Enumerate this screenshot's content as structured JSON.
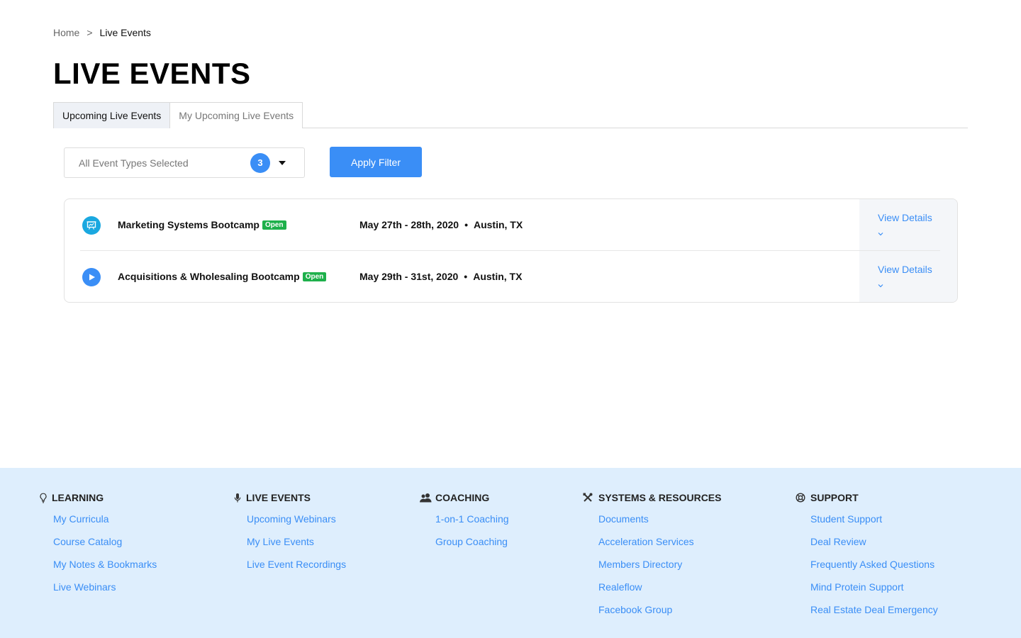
{
  "breadcrumb": {
    "home": "Home",
    "separator": ">",
    "current": "Live Events"
  },
  "page": {
    "title": "LIVE EVENTS"
  },
  "tabs": [
    {
      "label": "Upcoming Live Events",
      "active": true
    },
    {
      "label": "My Upcoming Live Events",
      "active": false
    }
  ],
  "filter": {
    "placeholder": "All Event Types Selected",
    "count": "3",
    "apply_label": "Apply Filter"
  },
  "events": [
    {
      "icon": "presentation-icon",
      "name": "Marketing Systems Bootcamp",
      "status": "Open",
      "dates": "May 27th - 28th, 2020",
      "separator": "•",
      "location": "Austin, TX",
      "details_label": "View Details"
    },
    {
      "icon": "play-icon",
      "name": "Acquisitions & Wholesaling Bootcamp",
      "status": "Open",
      "dates": "May 29th - 31st, 2020",
      "separator": "•",
      "location": "Austin, TX",
      "details_label": "View Details"
    }
  ],
  "footer": {
    "learning": {
      "icon": "lightbulb-icon",
      "heading": "LEARNING",
      "links": [
        "My Curricula",
        "Course Catalog",
        "My Notes & Bookmarks",
        "Live Webinars"
      ]
    },
    "live_events": {
      "icon": "microphone-icon",
      "heading": "LIVE EVENTS",
      "links": [
        "Upcoming Webinars",
        "My Live Events",
        "Live Event Recordings"
      ]
    },
    "coaching": {
      "icon": "users-icon",
      "heading": "COACHING",
      "links": [
        "1-on-1 Coaching",
        "Group Coaching"
      ]
    },
    "systems": {
      "icon": "tools-icon",
      "heading": "SYSTEMS & RESOURCES",
      "links": [
        "Documents",
        "Acceleration Services",
        "Members Directory",
        "Realeflow",
        "Facebook Group"
      ]
    },
    "support": {
      "icon": "lifebuoy-icon",
      "heading": "SUPPORT",
      "links": [
        "Student Support",
        "Deal Review",
        "Frequently Asked Questions",
        "Mind Protein Support",
        "Real Estate Deal Emergency"
      ]
    }
  },
  "colors": {
    "accent": "#3a8ef6",
    "open_badge": "#1eb04b",
    "footer_bg": "#deeefd",
    "details_bg": "#f4f6f9"
  }
}
